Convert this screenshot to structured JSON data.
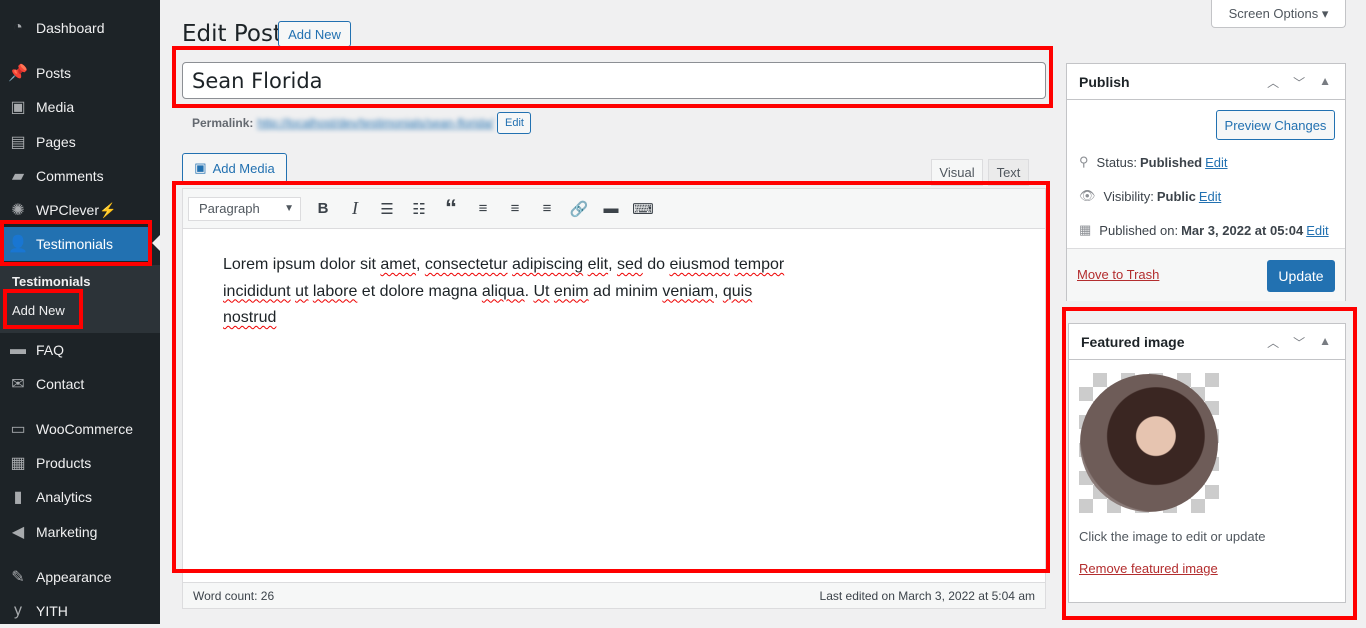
{
  "sidebar": {
    "items": [
      {
        "label": "Dashboard",
        "icon": "dashboard-icon",
        "glyph": "◔"
      },
      {
        "label": "Posts",
        "icon": "pin-icon",
        "glyph": "📌"
      },
      {
        "label": "Media",
        "icon": "media-icon",
        "glyph": "▣"
      },
      {
        "label": "Pages",
        "icon": "pages-icon",
        "glyph": "▤"
      },
      {
        "label": "Comments",
        "icon": "comment-icon",
        "glyph": "▰"
      },
      {
        "label": "WPClever",
        "icon": "wpclever-icon",
        "glyph": "✺",
        "suffix": "⚡"
      },
      {
        "label": "Testimonials",
        "icon": "user-icon",
        "glyph": "👤"
      },
      {
        "label": "FAQ",
        "icon": "folder-icon",
        "glyph": "▬"
      },
      {
        "label": "Contact",
        "icon": "mail-icon",
        "glyph": "✉"
      },
      {
        "label": "WooCommerce",
        "icon": "woo-icon",
        "glyph": "▭"
      },
      {
        "label": "Products",
        "icon": "products-icon",
        "glyph": "▦"
      },
      {
        "label": "Analytics",
        "icon": "analytics-icon",
        "glyph": "▮"
      },
      {
        "label": "Marketing",
        "icon": "megaphone-icon",
        "glyph": "◀"
      },
      {
        "label": "Appearance",
        "icon": "brush-icon",
        "glyph": "✎"
      },
      {
        "label": "YITH",
        "icon": "yith-icon",
        "glyph": "y"
      }
    ],
    "submenu": {
      "title": "Testimonials",
      "add_new": "Add New"
    }
  },
  "header": {
    "title": "Edit Post",
    "add_new": "Add New",
    "screen_options": "Screen Options ▾"
  },
  "post": {
    "title": "Sean Florida",
    "permalink_label": "Permalink:",
    "permalink_url": "http://localhost/dev/testimonials/sean-florida/",
    "permalink_edit": "Edit"
  },
  "editor": {
    "add_media": "Add Media",
    "tab_visual": "Visual",
    "tab_text": "Text",
    "format": "Paragraph",
    "lines": [
      [
        [
          "Lorem ipsum dolor sit ",
          0
        ],
        [
          "amet",
          1
        ],
        [
          ", ",
          0
        ],
        [
          "consectetur",
          1
        ],
        [
          " ",
          0
        ],
        [
          "adipiscing",
          1
        ],
        [
          " ",
          0
        ],
        [
          "elit",
          1
        ],
        [
          ", ",
          0
        ],
        [
          "sed",
          1
        ],
        [
          " do ",
          0
        ],
        [
          "eiusmod",
          1
        ],
        [
          " ",
          0
        ],
        [
          "tempor",
          1
        ]
      ],
      [
        [
          "incididunt",
          1
        ],
        [
          " ",
          0
        ],
        [
          "ut",
          1
        ],
        [
          " ",
          0
        ],
        [
          "labore",
          1
        ],
        [
          " et dolore magna ",
          0
        ],
        [
          "aliqua",
          1
        ],
        [
          ". ",
          0
        ],
        [
          "Ut",
          1
        ],
        [
          " ",
          0
        ],
        [
          "enim",
          1
        ],
        [
          " ad minim ",
          0
        ],
        [
          "veniam",
          1
        ],
        [
          ", ",
          0
        ],
        [
          "quis",
          1
        ]
      ],
      [
        [
          "nostrud",
          1
        ]
      ]
    ],
    "word_count": "Word count: 26",
    "last_edited": "Last edited on March 3, 2022 at 5:04 am"
  },
  "publish": {
    "title": "Publish",
    "preview": "Preview Changes",
    "status_label": "Status:",
    "status": "Published",
    "visibility_label": "Visibility:",
    "visibility": "Public",
    "published_label": "Published on:",
    "published": "Mar 3, 2022 at 05:04",
    "edit": "Edit",
    "trash": "Move to Trash",
    "update": "Update"
  },
  "featured": {
    "title": "Featured image",
    "hint": "Click the image to edit or update",
    "remove": "Remove featured image"
  },
  "colors": {
    "accent": "#2271b1",
    "sidebar": "#1d2327",
    "highlight": "#ff0000"
  }
}
